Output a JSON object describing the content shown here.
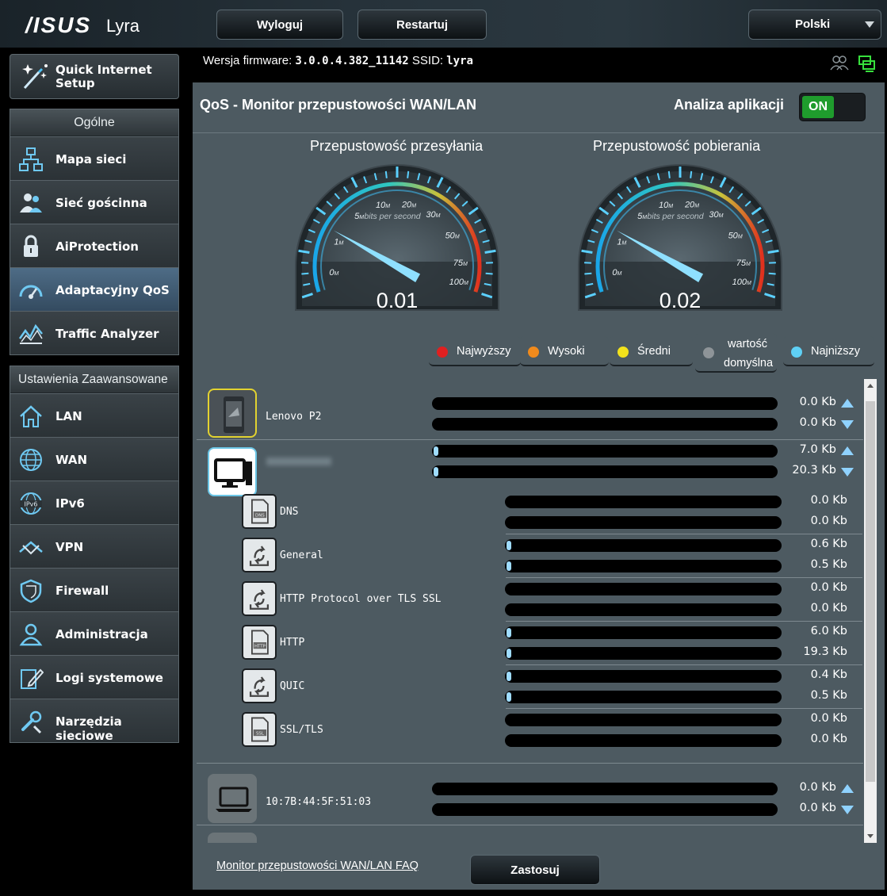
{
  "header": {
    "brand": "/ISUS",
    "product": "Lyra",
    "logout_label": "Wyloguj",
    "restart_label": "Restartuj",
    "language": "Polski"
  },
  "sidebar": {
    "quick_setup": "Quick Internet Setup",
    "general_title": "Ogólne",
    "general_items": [
      {
        "label": "Mapa sieci",
        "icon": "network-map-icon"
      },
      {
        "label": "Sieć gościnna",
        "icon": "guest-network-icon"
      },
      {
        "label": "AiProtection",
        "icon": "lock-icon"
      },
      {
        "label": "Adaptacyjny QoS",
        "icon": "speedometer-icon",
        "active": true
      },
      {
        "label": "Traffic Analyzer",
        "icon": "traffic-chart-icon"
      }
    ],
    "advanced_title": "Ustawienia Zaawansowane",
    "advanced_items": [
      {
        "label": "LAN",
        "icon": "home-icon"
      },
      {
        "label": "WAN",
        "icon": "globe-icon"
      },
      {
        "label": "IPv6",
        "icon": "ipv6-globe-icon"
      },
      {
        "label": "VPN",
        "icon": "vpn-icon"
      },
      {
        "label": "Firewall",
        "icon": "shield-icon"
      },
      {
        "label": "Administracja",
        "icon": "admin-user-icon"
      },
      {
        "label": "Logi systemowe",
        "icon": "log-edit-icon"
      },
      {
        "label": "Narzędzia sieciowe",
        "icon": "tools-icon"
      }
    ]
  },
  "firmware": {
    "label": "Wersja firmware:",
    "version": "3.0.0.4.382_11142",
    "ssid_label": "SSID:",
    "ssid": "lyra"
  },
  "panel": {
    "title": "QoS - Monitor przepustowości WAN/LAN",
    "app_analysis_label": "Analiza aplikacji",
    "toggle": "ON"
  },
  "gauges": {
    "upload_title": "Przepustowość przesyłania",
    "download_title": "Przepustowość pobierania",
    "unit_caption": "bits per second",
    "scale": [
      "0",
      "1",
      "5",
      "10",
      "20",
      "30",
      "50",
      "75",
      "100"
    ],
    "scale_unit": "M",
    "upload_value": "0.01",
    "download_value": "0.02"
  },
  "legend": [
    {
      "label": "Najwyższy",
      "color": "#e02020"
    },
    {
      "label": "Wysoki",
      "color": "#f08a1c"
    },
    {
      "label": "Średni",
      "color": "#f2e21c"
    },
    {
      "label": "wartość domyślna",
      "color": "#8e9498"
    },
    {
      "label": "Najniższy",
      "color": "#5fd0f5"
    }
  ],
  "clients": [
    {
      "name": "Lenovo P2",
      "icon": "phone-icon",
      "up": "0.0 Kb",
      "down": "0.0 Kb",
      "up_fill": 0,
      "down_fill": 0
    },
    {
      "name": "",
      "icon": "desktop-icon",
      "up": "7.0 Kb",
      "down": "20.3 Kb",
      "up_fill": 0.01,
      "down_fill": 0.01,
      "apps": [
        {
          "name": "DNS",
          "icon": "dns-file-icon",
          "up": "0.0 Kb",
          "down": "0.0 Kb",
          "up_fill": 0,
          "down_fill": 0
        },
        {
          "name": "General",
          "icon": "general-app-icon",
          "up": "0.6 Kb",
          "down": "0.5 Kb",
          "up_fill": 0.01,
          "down_fill": 0.01
        },
        {
          "name": "HTTP Protocol over TLS SSL",
          "icon": "general-app-icon",
          "up": "0.0 Kb",
          "down": "0.0 Kb",
          "up_fill": 0,
          "down_fill": 0
        },
        {
          "name": "HTTP",
          "icon": "http-file-icon",
          "up": "6.0 Kb",
          "down": "19.3 Kb",
          "up_fill": 0.01,
          "down_fill": 0.01
        },
        {
          "name": "QUIC",
          "icon": "general-app-icon",
          "up": "0.4 Kb",
          "down": "0.5 Kb",
          "up_fill": 0.01,
          "down_fill": 0.01
        },
        {
          "name": "SSL/TLS",
          "icon": "ssl-file-icon",
          "up": "0.0 Kb",
          "down": "0.0 Kb",
          "up_fill": 0,
          "down_fill": 0
        }
      ]
    },
    {
      "name": "10:7B:44:5F:51:03",
      "icon": "laptop-icon",
      "up": "0.0 Kb",
      "down": "0.0 Kb",
      "up_fill": 0,
      "down_fill": 0
    }
  ],
  "footer": {
    "faq_link": "Monitor przepustowości WAN/LAN FAQ",
    "apply_label": "Zastosuj"
  }
}
